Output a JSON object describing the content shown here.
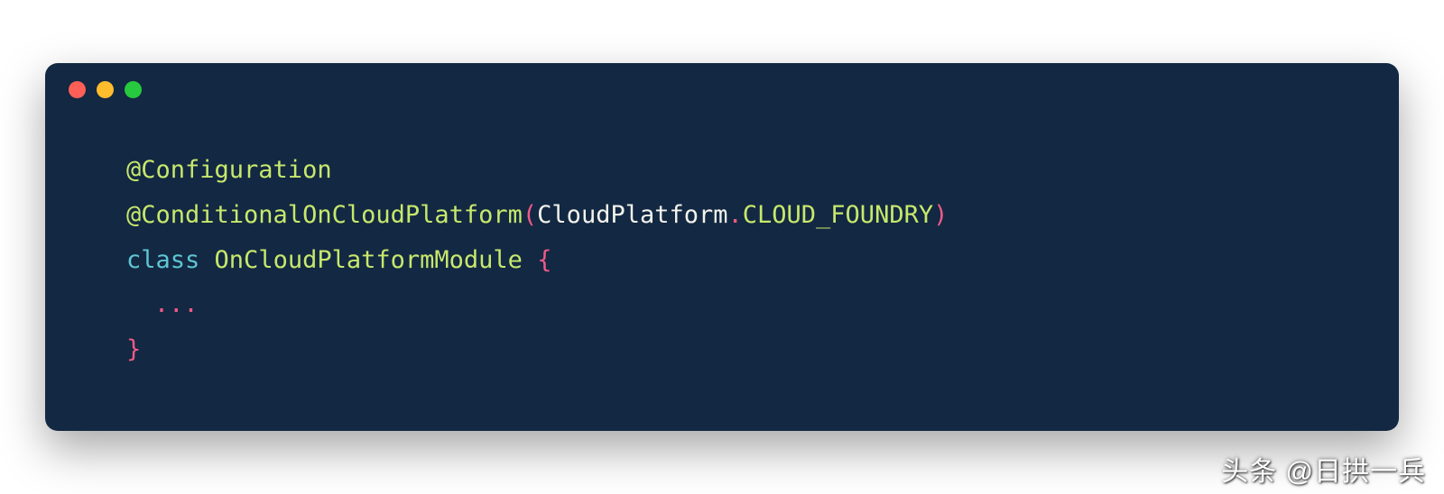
{
  "code": {
    "line1": {
      "annotation": "@Configuration"
    },
    "line2": {
      "annotation": "@ConditionalOnCloudPlatform",
      "openParen": "(",
      "className": "CloudPlatform",
      "dot": ".",
      "constant": "CLOUD_FOUNDRY",
      "closeParen": ")"
    },
    "line3": {
      "keyword": "class",
      "typeName": "OnCloudPlatformModule",
      "openBrace": "{"
    },
    "line4": {
      "ellipsis": "..."
    },
    "line5": {
      "closeBrace": "}"
    }
  },
  "watermark": "头条 @日拱一兵"
}
